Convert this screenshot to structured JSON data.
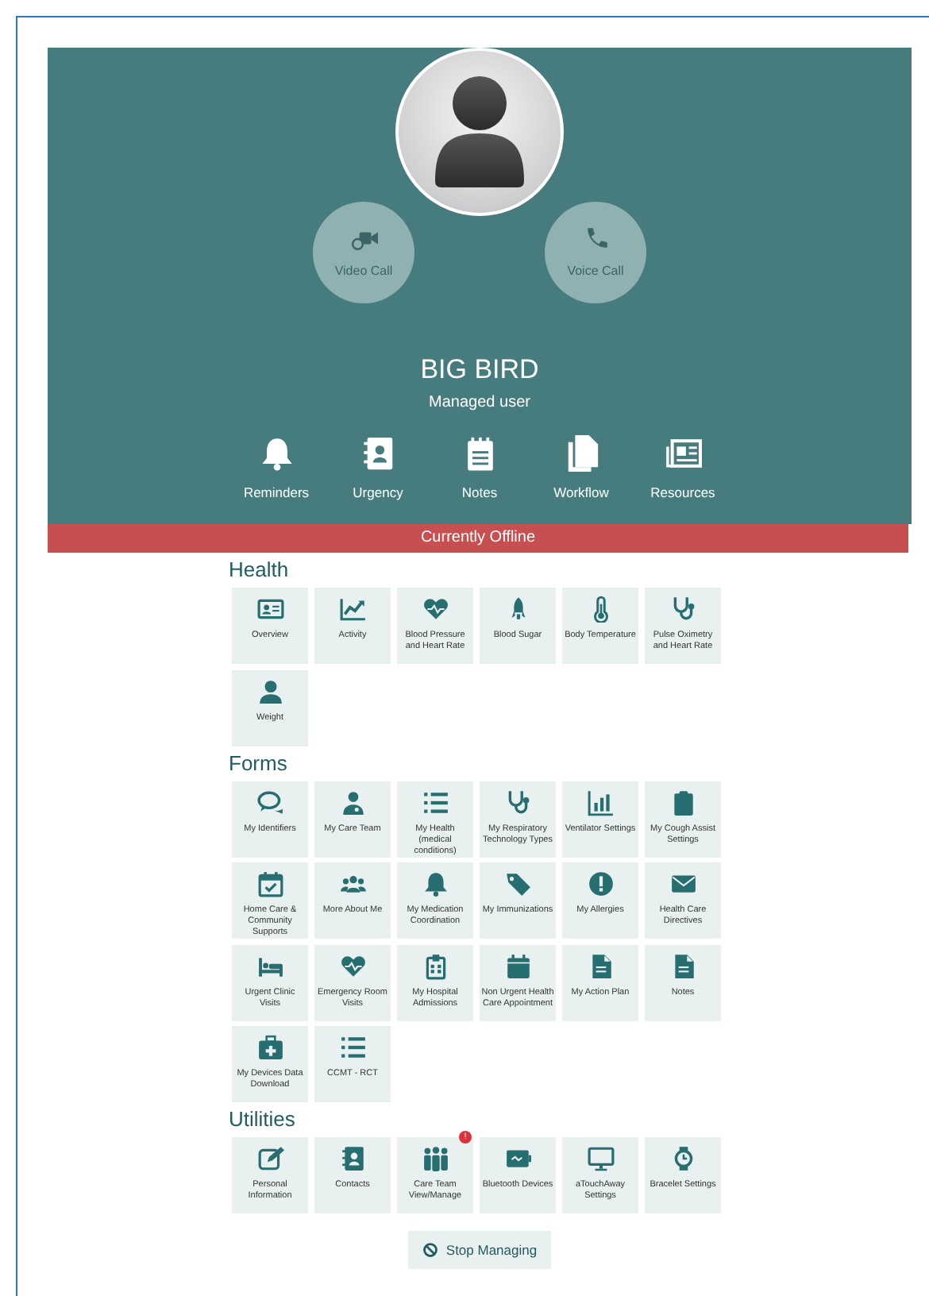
{
  "profile": {
    "name": "BIG BIRD",
    "role": "Managed user"
  },
  "calls": [
    {
      "label": "Video Call"
    },
    {
      "label": "Voice Call"
    }
  ],
  "quick_links": [
    {
      "label": "Reminders"
    },
    {
      "label": "Urgency"
    },
    {
      "label": "Notes"
    },
    {
      "label": "Workflow"
    },
    {
      "label": "Resources"
    }
  ],
  "status_banner": "Currently Offline",
  "sections": [
    {
      "title": "Health",
      "tiles": [
        {
          "label": "Overview"
        },
        {
          "label": "Activity"
        },
        {
          "label": "Blood Pressure and Heart Rate"
        },
        {
          "label": "Blood Sugar"
        },
        {
          "label": "Body Temperature"
        },
        {
          "label": "Pulse Oximetry and Heart Rate"
        },
        {
          "label": "Weight"
        }
      ]
    },
    {
      "title": "Forms",
      "tiles": [
        {
          "label": "My Identifiers"
        },
        {
          "label": "My Care Team"
        },
        {
          "label": "My Health (medical conditions)"
        },
        {
          "label": "My Respiratory Technology Types"
        },
        {
          "label": "Ventilator Settings"
        },
        {
          "label": "My Cough Assist Settings"
        },
        {
          "label": "Home Care & Community Supports"
        },
        {
          "label": "More About Me"
        },
        {
          "label": "My Medication Coordination"
        },
        {
          "label": "My Immunizations"
        },
        {
          "label": "My Allergies"
        },
        {
          "label": "Health Care Directives"
        },
        {
          "label": "Urgent Clinic Visits"
        },
        {
          "label": "Emergency Room Visits"
        },
        {
          "label": "My Hospital Admissions"
        },
        {
          "label": "Non Urgent Health Care Appointment"
        },
        {
          "label": "My Action Plan"
        },
        {
          "label": "Notes"
        },
        {
          "label": "My Devices Data Download"
        },
        {
          "label": "CCMT - RCT"
        }
      ]
    },
    {
      "title": "Utilities",
      "tiles": [
        {
          "label": "Personal Information"
        },
        {
          "label": "Contacts"
        },
        {
          "label": "Care Team View/Manage",
          "badge": "!"
        },
        {
          "label": "Bluetooth Devices"
        },
        {
          "label": "aTouchAway Settings"
        },
        {
          "label": "Bracelet Settings"
        }
      ]
    }
  ],
  "stop_button": "Stop Managing"
}
